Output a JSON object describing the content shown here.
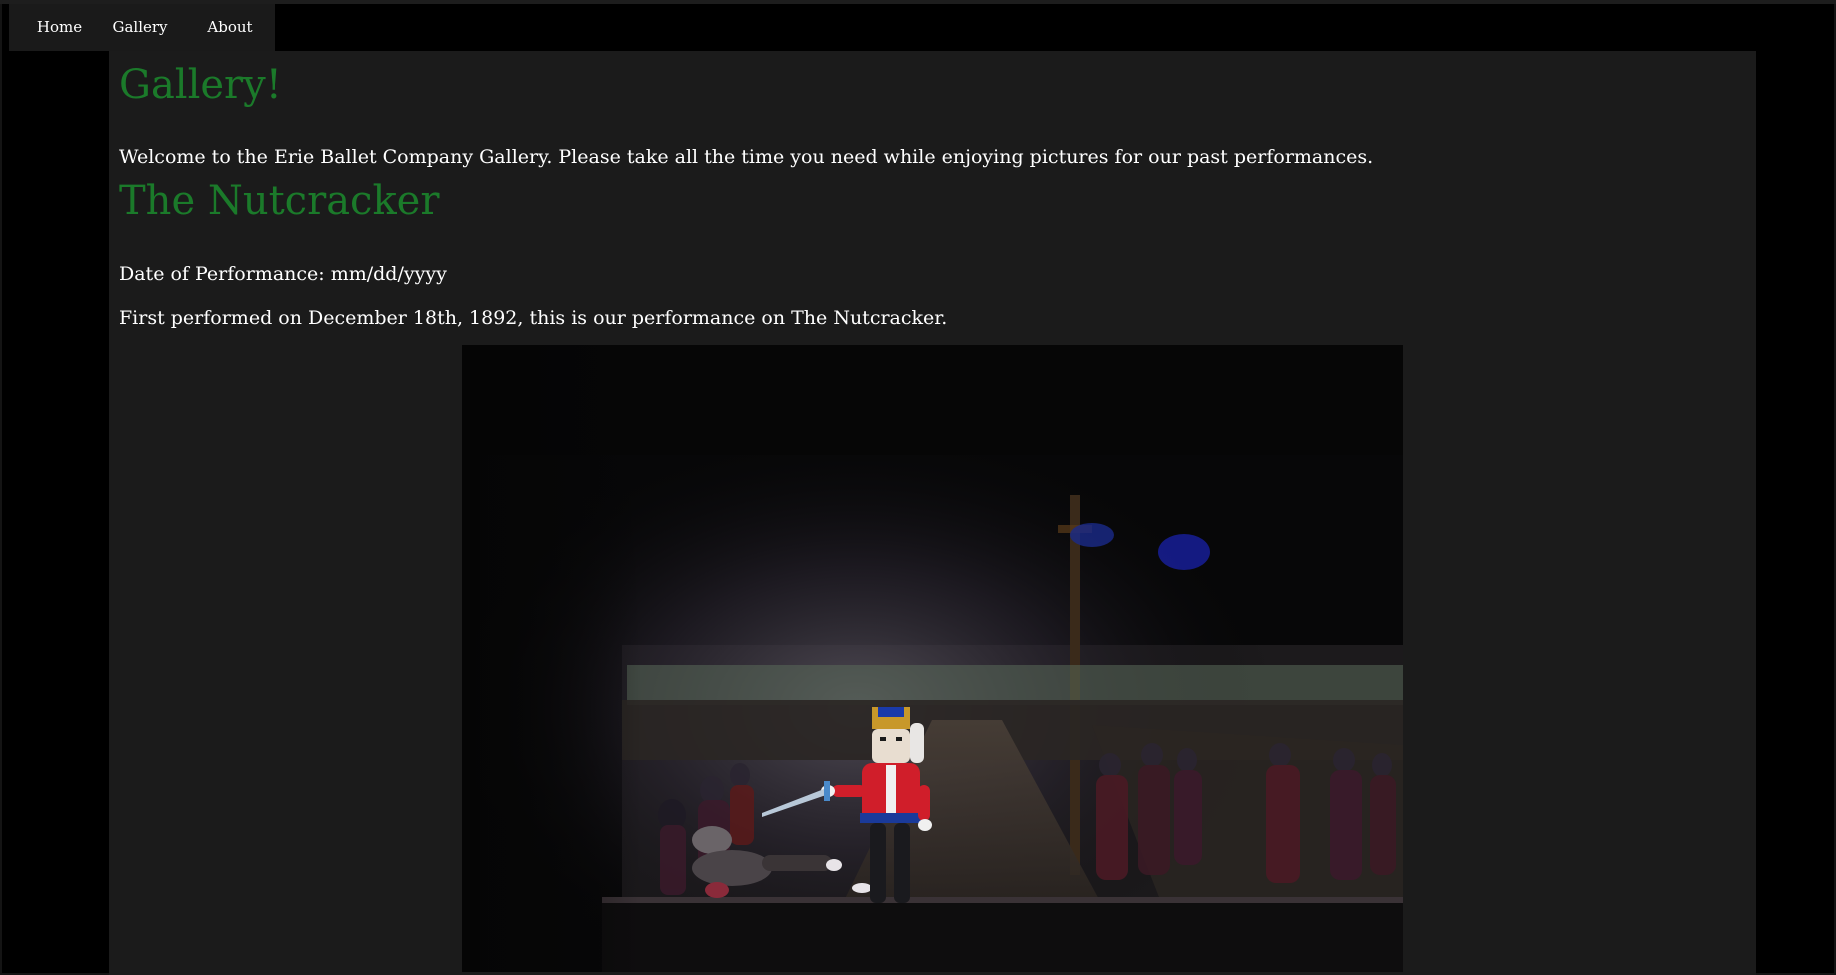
{
  "nav": {
    "items": [
      {
        "label": "Home"
      },
      {
        "label": "Gallery"
      },
      {
        "label": "About"
      }
    ]
  },
  "page": {
    "title": "Gallery!",
    "intro": "Welcome to the Erie Ballet Company Gallery. Please take all the time you need while enjoying pictures for our past performances."
  },
  "performance": {
    "title": "The Nutcracker",
    "date_line": "Date of Performance: mm/dd/yyyy",
    "description": "First performed on December 18th, 1892, this is our performance on The Nutcracker.",
    "photo_subject": "nutcracker-stage-performance"
  },
  "colors": {
    "heading": "#1b7a2a",
    "text": "#ffffff",
    "content_bg": "#1b1b1b",
    "page_bg": "#000000",
    "nav_bg": "#1a1a1a"
  }
}
